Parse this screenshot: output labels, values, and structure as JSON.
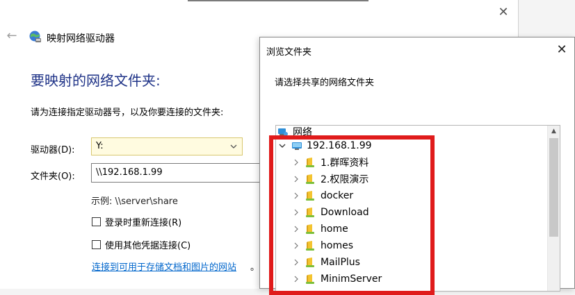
{
  "wizard": {
    "title": "映射网络驱动器",
    "heading": "要映射的网络文件夹:",
    "instruction": "请为连接指定驱动器号，以及你要连接的文件夹:",
    "drive_label": "驱动器(D):",
    "drive_value": "Y:",
    "folder_label": "文件夹(O):",
    "folder_value": "\\\\192.168.1.99",
    "example": "示例: \\\\server\\share",
    "reconnect_label": "登录时重新连接(R)",
    "credentials_label": "使用其他凭据连接(C)",
    "link_text": "连接到可用于存储文档和图片的网站",
    "link_tail": "。"
  },
  "browse": {
    "title": "浏览文件夹",
    "prompt": "请选择共享的网络文件夹",
    "root": "网络",
    "host": "192.168.1.99",
    "folders": [
      "1.群晖资料",
      "2.权限演示",
      "docker",
      "Download",
      "home",
      "homes",
      "MailPlus",
      "MinimServer"
    ]
  },
  "colors": {
    "heading": "#1e3287",
    "link": "#0066cc",
    "highlight": "#e01b1b",
    "folder": "#f4c430"
  }
}
